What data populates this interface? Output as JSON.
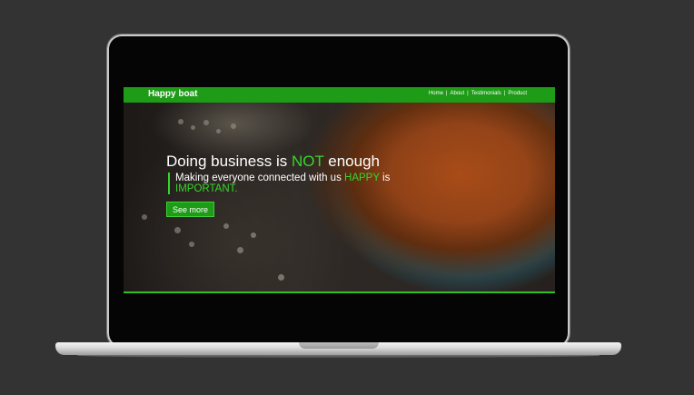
{
  "navbar": {
    "brand": "Happy boat",
    "links": [
      "Home",
      "About",
      "Testimonials",
      "Product"
    ],
    "separator": "|"
  },
  "hero": {
    "headline_before": "Doing business is ",
    "headline_highlight": "NOT",
    "headline_after": " enough",
    "subtext_before": "Making everyone connected with us ",
    "subtext_highlight1": "HAPPY",
    "subtext_middle": " is ",
    "subtext_highlight2": "IMPORTANT.",
    "cta_label": "See more"
  },
  "colors": {
    "accent": "#1e9b17",
    "highlight": "#35d62a",
    "background": "#333333"
  }
}
